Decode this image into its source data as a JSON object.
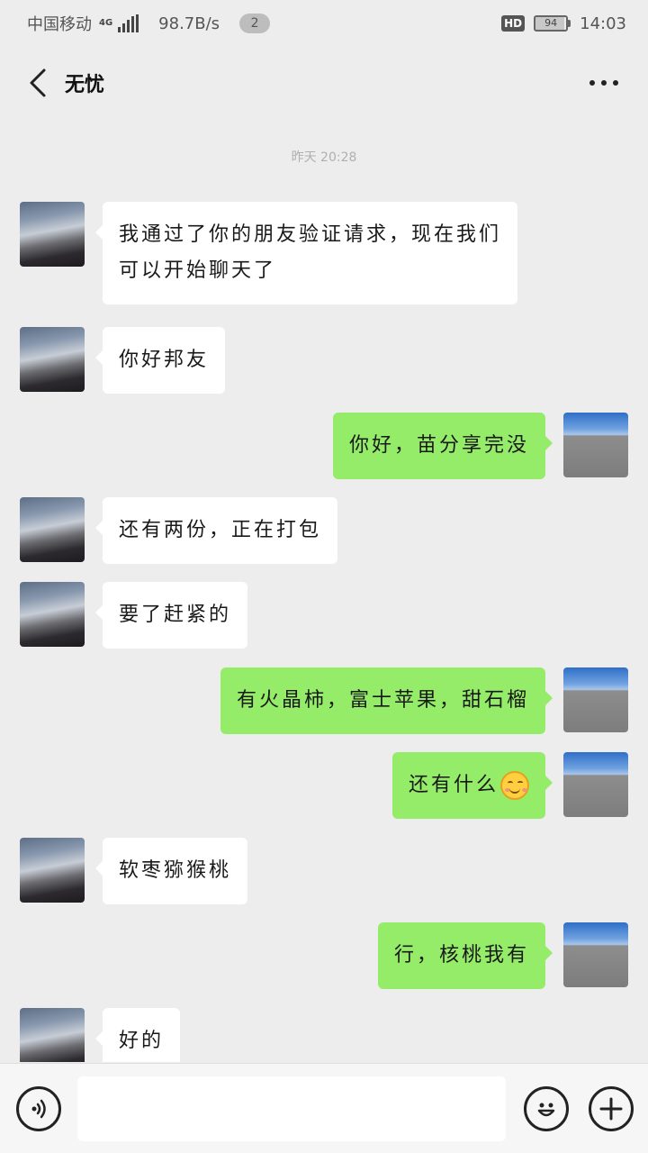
{
  "status_bar": {
    "carrier": "中国移动",
    "network": "4G",
    "speed": "98.7B/s",
    "notification_count": "2",
    "hd": "HD",
    "battery": "94",
    "time": "14:03"
  },
  "header": {
    "back_icon": "chevron-left-icon",
    "title": "无忧",
    "more_icon": "more-dots-icon"
  },
  "chat": {
    "timestamp": "昨天 20:28",
    "messages": [
      {
        "side": "left",
        "text": "我通过了你的朋友验证请求，现在我们\n可以开始聊天了"
      },
      {
        "side": "left",
        "text": "你好邦友"
      },
      {
        "side": "right",
        "text": "你好，苗分享完没"
      },
      {
        "side": "left",
        "text": "还有两份，正在打包"
      },
      {
        "side": "left",
        "text": "要了赶紧的"
      },
      {
        "side": "right",
        "text": "有火晶柿，富士苹果，甜石榴"
      },
      {
        "side": "right",
        "text": "还有什么",
        "emoji": "smiling-face-icon"
      },
      {
        "side": "left",
        "text": "软枣猕猴桃"
      },
      {
        "side": "right",
        "text": "行，核桃我有"
      },
      {
        "side": "left",
        "text": "好的"
      }
    ]
  },
  "input_bar": {
    "voice_icon": "voice-icon",
    "input_value": "",
    "emoji_icon": "emoji-icon",
    "plus_icon": "plus-icon"
  }
}
